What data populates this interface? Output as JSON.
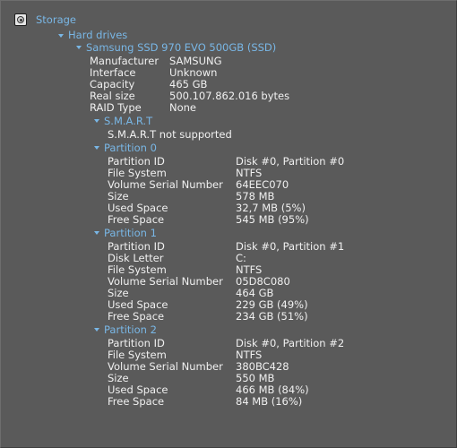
{
  "tree": {
    "root_label": "Storage",
    "hard_drives_label": "Hard drives",
    "drive": {
      "label": "Samsung SSD 970 EVO 500GB (SSD)",
      "props": [
        {
          "label": "Manufacturer",
          "value": "SAMSUNG"
        },
        {
          "label": "Interface",
          "value": "Unknown"
        },
        {
          "label": "Capacity",
          "value": "465 GB"
        },
        {
          "label": "Real size",
          "value": "500.107.862.016 bytes"
        },
        {
          "label": "RAID Type",
          "value": "None"
        }
      ],
      "smart": {
        "label": "S.M.A.R.T",
        "status": "S.M.A.R.T not supported"
      },
      "partitions": [
        {
          "label": "Partition 0",
          "props": [
            {
              "label": "Partition ID",
              "value": "Disk #0, Partition #0"
            },
            {
              "label": "File System",
              "value": "NTFS"
            },
            {
              "label": "Volume Serial Number",
              "value": "64EEC070"
            },
            {
              "label": "Size",
              "value": "578 MB"
            },
            {
              "label": "Used Space",
              "value": "32,7 MB (5%)"
            },
            {
              "label": "Free Space",
              "value": "545 MB (95%)"
            }
          ]
        },
        {
          "label": "Partition 1",
          "props": [
            {
              "label": "Partition ID",
              "value": "Disk #0, Partition #1"
            },
            {
              "label": "Disk Letter",
              "value": "C:"
            },
            {
              "label": "File System",
              "value": "NTFS"
            },
            {
              "label": "Volume Serial Number",
              "value": "05D8C080"
            },
            {
              "label": "Size",
              "value": "464 GB"
            },
            {
              "label": "Used Space",
              "value": "229 GB (49%)"
            },
            {
              "label": "Free Space",
              "value": "234 GB (51%)"
            }
          ]
        },
        {
          "label": "Partition 2",
          "props": [
            {
              "label": "Partition ID",
              "value": "Disk #0, Partition #2"
            },
            {
              "label": "File System",
              "value": "NTFS"
            },
            {
              "label": "Volume Serial Number",
              "value": "380BC428"
            },
            {
              "label": "Size",
              "value": "550 MB"
            },
            {
              "label": "Used Space",
              "value": "466 MB (84%)"
            },
            {
              "label": "Free Space",
              "value": "84 MB (16%)"
            }
          ]
        }
      ]
    }
  },
  "colors": {
    "background": "#5a5a5a",
    "text": "#f0f0f0",
    "tree_label": "#79b7e6"
  }
}
